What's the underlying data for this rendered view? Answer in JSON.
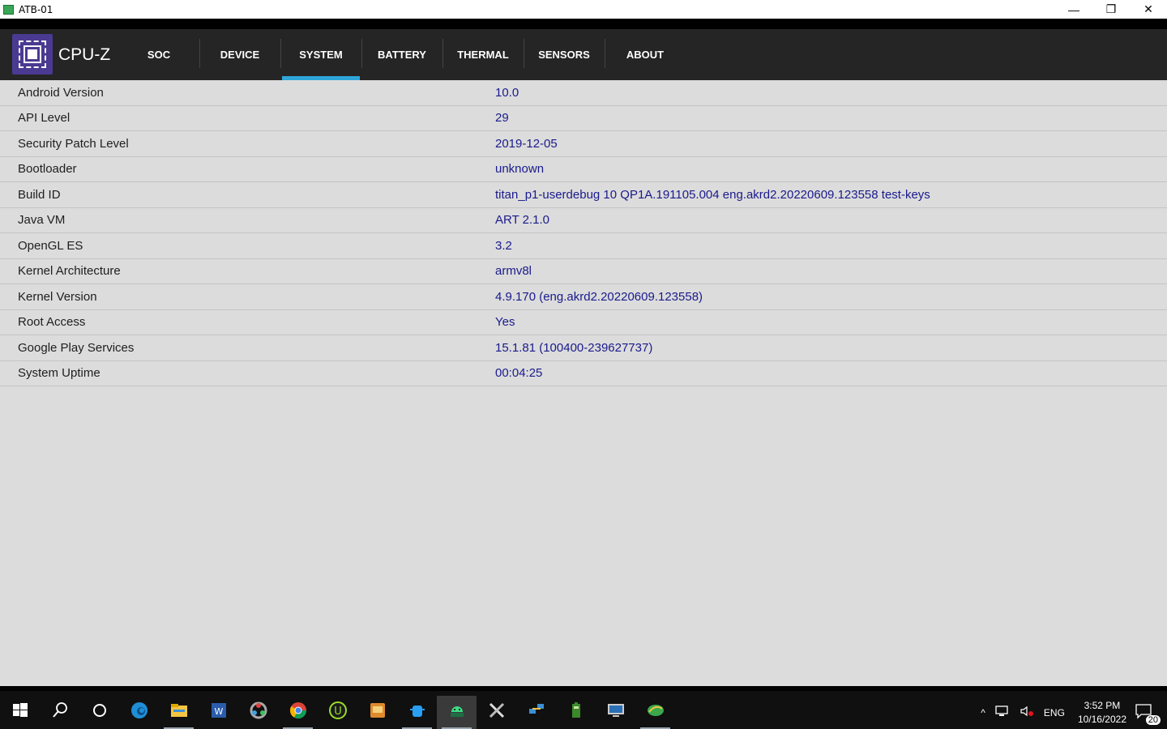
{
  "window": {
    "title": "ATB-01",
    "min_glyph": "—",
    "restore_glyph": "❐",
    "close_glyph": "✕"
  },
  "app": {
    "name": "CPU-Z",
    "tabs": [
      {
        "label": "SOC",
        "active": false
      },
      {
        "label": "DEVICE",
        "active": false
      },
      {
        "label": "SYSTEM",
        "active": true
      },
      {
        "label": "BATTERY",
        "active": false
      },
      {
        "label": "THERMAL",
        "active": false
      },
      {
        "label": "SENSORS",
        "active": false
      },
      {
        "label": "ABOUT",
        "active": false
      }
    ],
    "accent_color": "#2fa6d9",
    "value_color": "#1a1a8c"
  },
  "system_info": [
    {
      "label": "Android Version",
      "value": "10.0"
    },
    {
      "label": "API Level",
      "value": "29"
    },
    {
      "label": "Security Patch Level",
      "value": "2019-12-05"
    },
    {
      "label": "Bootloader",
      "value": "unknown"
    },
    {
      "label": "Build ID",
      "value": "titan_p1-userdebug 10 QP1A.191105.004 eng.akrd2.20220609.123558 test-keys"
    },
    {
      "label": "Java VM",
      "value": "ART 2.1.0"
    },
    {
      "label": "OpenGL ES",
      "value": "3.2"
    },
    {
      "label": "Kernel Architecture",
      "value": "armv8l"
    },
    {
      "label": "Kernel Version",
      "value": "4.9.170 (eng.akrd2.20220609.123558)"
    },
    {
      "label": "Root Access",
      "value": "Yes"
    },
    {
      "label": "Google Play Services",
      "value": "15.1.81 (100400-239627737)"
    },
    {
      "label": "System Uptime",
      "value": "00:04:25"
    }
  ],
  "taskbar": {
    "apps": [
      {
        "name": "start-icon",
        "running": false
      },
      {
        "name": "search-icon",
        "running": false
      },
      {
        "name": "cortana-icon",
        "running": false
      },
      {
        "name": "edge-icon",
        "running": false
      },
      {
        "name": "file-explorer-icon",
        "running": true
      },
      {
        "name": "word-icon",
        "running": false
      },
      {
        "name": "davinci-icon",
        "running": false
      },
      {
        "name": "chrome-icon",
        "running": true
      },
      {
        "name": "intellij-icon",
        "running": false
      },
      {
        "name": "hxd-icon",
        "running": false
      },
      {
        "name": "android-debug-icon",
        "running": true
      },
      {
        "name": "android-emulator-icon",
        "running": true
      },
      {
        "name": "tools-icon",
        "running": false
      },
      {
        "name": "network-config-icon",
        "running": false
      },
      {
        "name": "battery-app-icon",
        "running": false
      },
      {
        "name": "remote-desktop-icon",
        "running": false
      },
      {
        "name": "internet-download-icon",
        "running": true
      }
    ],
    "tray": {
      "chevron": "^",
      "language": "ENG",
      "time": "3:52 PM",
      "date": "10/16/2022",
      "notification_count": "20"
    }
  }
}
